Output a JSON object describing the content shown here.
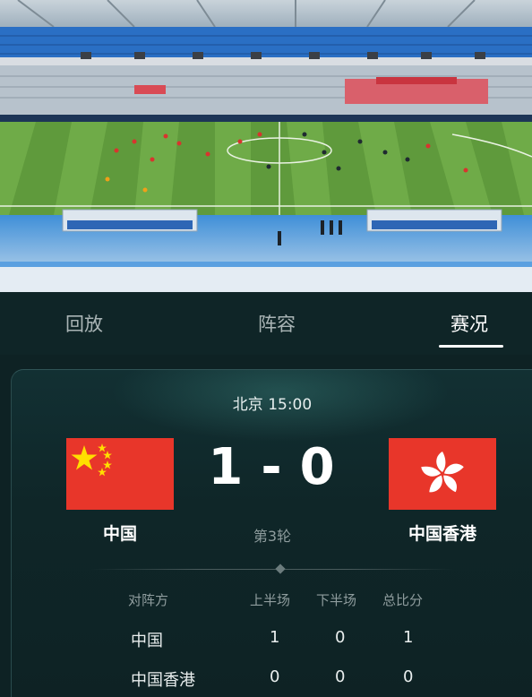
{
  "tabs": [
    {
      "label": "回放",
      "active": false
    },
    {
      "label": "阵容",
      "active": false
    },
    {
      "label": "赛况",
      "active": true
    }
  ],
  "match": {
    "venue_time": "北京 15:00",
    "home": {
      "name": "中国",
      "score": "1",
      "flag": "china-flag-icon"
    },
    "away": {
      "name": "中国香港",
      "score": "0",
      "flag": "hong-kong-flag-icon"
    },
    "separator": "-",
    "round": "第3轮"
  },
  "score_table": {
    "headers": [
      "对阵方",
      "上半场",
      "下半场",
      "总比分"
    ],
    "rows": [
      {
        "team": "中国",
        "first_half": "1",
        "second_half": "0",
        "total": "1"
      },
      {
        "team": "中国香港",
        "first_half": "0",
        "second_half": "0",
        "total": "0"
      }
    ]
  },
  "colors": {
    "background": "#0e2224",
    "tab_active": "#ffffff",
    "tab_inactive": "#a9b4b5",
    "flag_red": "#e8362a",
    "pitch_green": "#5f9a3c",
    "stands_blue": "#2a6fc4"
  }
}
